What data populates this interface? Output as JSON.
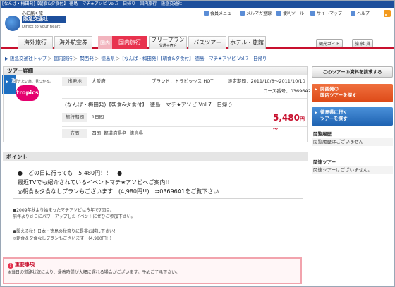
{
  "topbar": {
    "text": "[なんば・梅田発]【朝食&夕食付】 徳島　マチ★アソビ Vol.7　日帰り｜国内旅行｜阪急交通社"
  },
  "logo": {
    "tagline": "心に届く旅",
    "name": "阪急交通社",
    "english": "Direct to your heart"
  },
  "utility": [
    {
      "label": "会員メニュー",
      "icon": "member-icon",
      "color": "#5b8dd6"
    },
    {
      "label": "メルマガ登録",
      "icon": "mail-icon",
      "color": "#5b8dd6"
    },
    {
      "label": "便利ツール",
      "icon": "tool-icon",
      "color": "#5b8dd6"
    },
    {
      "label": "サイトマップ",
      "icon": "sitemap-icon",
      "color": "#5b8dd6"
    },
    {
      "label": "ヘルプ",
      "icon": "help-icon",
      "color": "#5b8dd6"
    }
  ],
  "gnav": {
    "kaigai": "海外",
    "kaigai_ryoko": "海外旅行",
    "kaigai_kuko": "海外航空券",
    "kokunai": "国内",
    "kokunai_ryoko": "国内旅行",
    "freeplan": "フリープラン",
    "freeplan_sub": "交通＋宿泊",
    "bustour": "バスツアー",
    "hotel": "ホテル・旅館",
    "kanko": "観光ガイド",
    "tabi": "旅 雑 貨"
  },
  "breadcrumb": [
    "阪急交通社トップ",
    "国内旅行",
    "関西発",
    "徳島県",
    "[なんば・梅田発]【朝食&夕食付】 徳島　マチ★アソビ Vol.7　日帰り"
  ],
  "tour": {
    "section_title": "ツアー詳細",
    "brand_tagline": "行きたい旅、見つかる。",
    "brand_logo": "tropics",
    "dep_label": "出発地",
    "dep_value": "大阪府",
    "brand": "ブランド：トラピックス HOT",
    "period": "設定期間：2011/10/8～2011/10/10",
    "course": "コース番号：03696A2",
    "title": "(なんば・梅田発)【朝食&夕食付】　徳島　マチ★アソビ Vol.7　日帰り",
    "days_label": "旅行期間",
    "days_value": "1日間",
    "price": "5,480",
    "price_unit": "円～",
    "area_label": "方面",
    "area_region": "四国",
    "area_pref_label": "都道府県名",
    "area_pref": "徳島県"
  },
  "point": {
    "heading": "ポイント",
    "line1": "●　どの日に行っても　5,480円！！　●",
    "line2": "最近TVでも紹介されているイベントマチ★アソビへご案内!!",
    "line3": "◎朝食＆夕食なしプランもございます　(4,980円!!)　⇒03696A1をご覧下さい",
    "note1": "●2009年秋より始まったマチアソビは今年で7回目。",
    "note2": "前年よりさらにパワーアップしたイベントにぜひご参加下さい。",
    "note3": "●聞える秋！日本・徳島の秋祭りに是非お越し下さい！",
    "note4": "◎朝食＆夕食なしプランもございます　(4,980円!!)"
  },
  "warning": {
    "title": "重要事項",
    "body": "※当日の道路状況により、帰着時間が大幅に遅れる場合がございます。予めご了承下さい。"
  },
  "side": {
    "download": "このツアーの資料を請求する",
    "kansai_line1": "関西発の",
    "kansai_line2": "国内ツアーを探す",
    "tokushima_line1": "徳島県に行く",
    "tokushima_line2": "ツアーを探す",
    "history_title": "閲覧履歴",
    "history_empty": "閲覧履歴はございません",
    "related_title": "関連ツアー",
    "related_empty": "関連ツアーはございません。"
  }
}
